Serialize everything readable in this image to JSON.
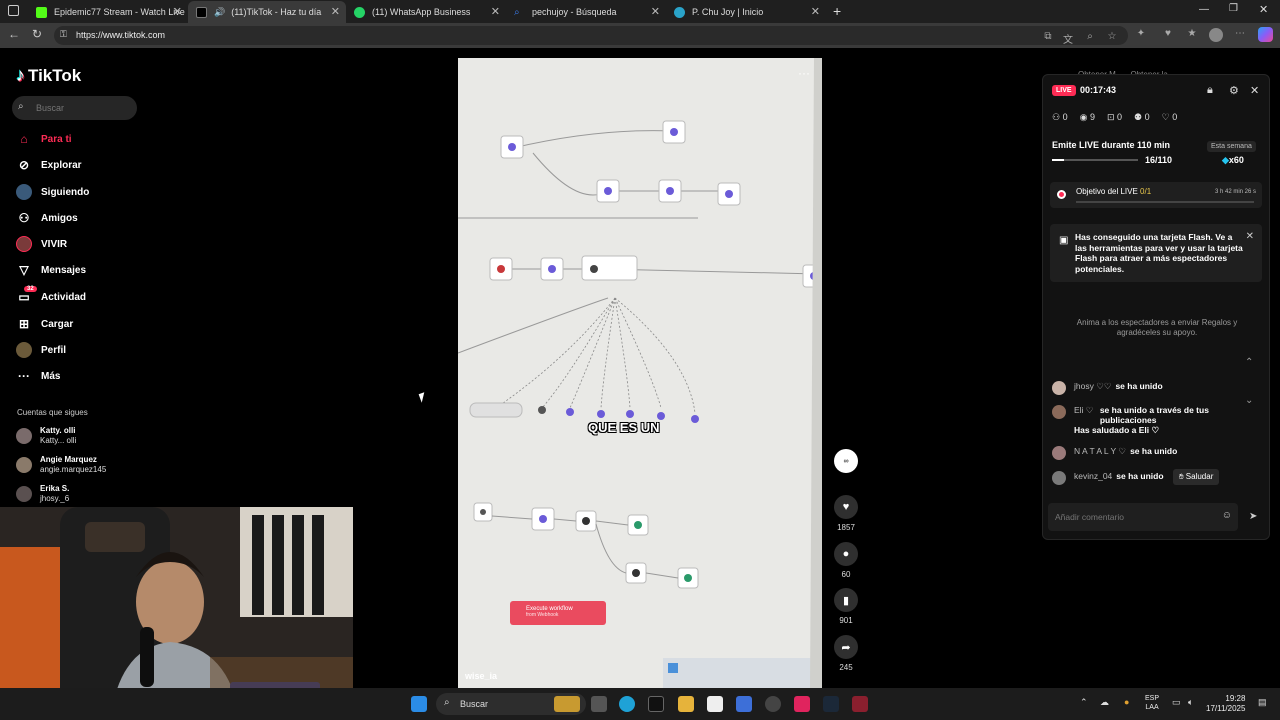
{
  "browser": {
    "tabs": [
      {
        "title": "Epidemic77 Stream - Watch Live",
        "color": "#53fc18"
      },
      {
        "title": "(11)TikTok - Haz tu día",
        "color": "#000000"
      },
      {
        "title": "(11) WhatsApp Business",
        "color": "#25d366"
      },
      {
        "title": "pechujoy - Búsqueda",
        "color": "#3b7be9"
      },
      {
        "title": "P. Chu Joy | Inicio",
        "color": "#2aa3c9"
      }
    ],
    "new_tab": "+",
    "url": "https://www.tiktok.com"
  },
  "sidebar": {
    "logo": "TikTok",
    "search_placeholder": "Buscar",
    "items": [
      {
        "label": "Para ti",
        "icon": "home-icon",
        "active": true
      },
      {
        "label": "Explorar",
        "icon": "compass-icon"
      },
      {
        "label": "Siguiendo",
        "icon": "following-icon"
      },
      {
        "label": "Amigos",
        "icon": "friends-icon"
      },
      {
        "label": "VIVIR",
        "icon": "live-icon"
      },
      {
        "label": "Mensajes",
        "icon": "messages-icon"
      },
      {
        "label": "Actividad",
        "icon": "activity-icon",
        "badge": "32"
      },
      {
        "label": "Cargar",
        "icon": "upload-icon"
      },
      {
        "label": "Perfil",
        "icon": "profile-icon"
      },
      {
        "label": "Más",
        "icon": "more-icon"
      }
    ],
    "following_title": "Cuentas que sigues",
    "following": [
      {
        "name": "Katty. olli",
        "user": "Katty... olli"
      },
      {
        "name": "Angie Marquez",
        "user": "angie.marquez145"
      },
      {
        "name": "Erika S.",
        "user": "jhosy._6"
      }
    ]
  },
  "video": {
    "caption": "QUE ES UN",
    "username": "wise_ia",
    "execute_button": "Execute workflow",
    "execute_sub": "from Webhook",
    "actions": [
      {
        "name": "like",
        "count": "1857",
        "icon": "heart-icon"
      },
      {
        "name": "comment",
        "count": "60",
        "icon": "comment-icon"
      },
      {
        "name": "save",
        "count": "901",
        "icon": "bookmark-icon"
      },
      {
        "name": "share",
        "count": "245",
        "icon": "share-icon"
      }
    ]
  },
  "live_panel": {
    "obtener": [
      "Obtener M...",
      "Obtener la ..."
    ],
    "badge": "LIVE",
    "timer": "00:17:43",
    "stats": [
      {
        "icon": "people-icon",
        "value": "0"
      },
      {
        "icon": "eye-icon",
        "value": "9"
      },
      {
        "icon": "gift-icon",
        "value": "0"
      },
      {
        "icon": "user-add-icon",
        "value": "0"
      },
      {
        "icon": "heart-icon",
        "value": "0"
      }
    ],
    "emite": "Emite LIVE durante 110 min",
    "week": "Esta semana",
    "progress_text": "16/110",
    "progress_fraction": 0.145,
    "multiplier": "x60",
    "objective_label": "Objetivo del LIVE",
    "objective_value": "0/1",
    "objective_time": "3 h 42 min 26 s",
    "flash_text": "Has conseguido una tarjeta Flash. Ve a las herramientas para ver y usar la tarjeta Flash para atraer a más espectadores potenciales.",
    "anima_text": "Anima a los espectadores a enviar Regalos y agradéceles su apoyo.",
    "chat": [
      {
        "name": "jhosy ♡♡",
        "msg": "se ha unido"
      },
      {
        "name": "Eli ♡",
        "msg": "se ha unido a través de tus publicaciones"
      },
      {
        "name": "",
        "msg": "Has saludado a Eli ♡"
      },
      {
        "name": "N A T A L Y ♡",
        "msg": "se ha unido"
      },
      {
        "name": "kevinz_04",
        "msg": "se ha unido"
      }
    ],
    "saludar": "Saludar",
    "comment_placeholder": "Añadir comentario"
  },
  "taskbar": {
    "search": "Buscar",
    "lang_top": "ESP",
    "lang_bottom": "LAA",
    "time": "19:28",
    "date": "17/11/2025"
  }
}
